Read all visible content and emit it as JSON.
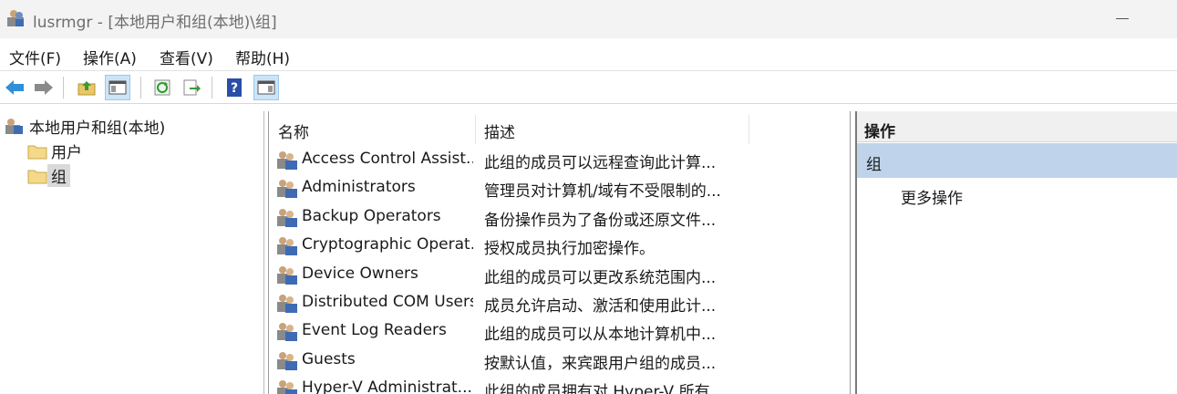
{
  "window": {
    "title": "lusrmgr - [本地用户和组(本地)\\组]"
  },
  "menu": {
    "file": "文件(F)",
    "action": "操作(A)",
    "view": "查看(V)",
    "help": "帮助(H)"
  },
  "tree": {
    "root": "本地用户和组(本地)",
    "users": "用户",
    "groups": "组"
  },
  "list": {
    "col_name": "名称",
    "col_desc": "描述",
    "rows": [
      {
        "name": "Access Control Assist...",
        "desc": "此组的成员可以远程查询此计算..."
      },
      {
        "name": "Administrators",
        "desc": "管理员对计算机/域有不受限制的..."
      },
      {
        "name": "Backup Operators",
        "desc": "备份操作员为了备份或还原文件..."
      },
      {
        "name": "Cryptographic Operat...",
        "desc": "授权成员执行加密操作。"
      },
      {
        "name": "Device Owners",
        "desc": "此组的成员可以更改系统范围内..."
      },
      {
        "name": "Distributed COM Users",
        "desc": "成员允许启动、激活和使用此计..."
      },
      {
        "name": "Event Log Readers",
        "desc": "此组的成员可以从本地计算机中..."
      },
      {
        "name": "Guests",
        "desc": "按默认值，来宾跟用户组的成员..."
      },
      {
        "name": "Hyper-V Administrat...",
        "desc": "此组的成员拥有对 Hyper-V 所有..."
      }
    ]
  },
  "actions": {
    "header": "操作",
    "group": "组",
    "more": "更多操作"
  },
  "colors": {
    "selected_group_bg": "#bfd3ea",
    "toolbar_active": "#cce4f7"
  }
}
